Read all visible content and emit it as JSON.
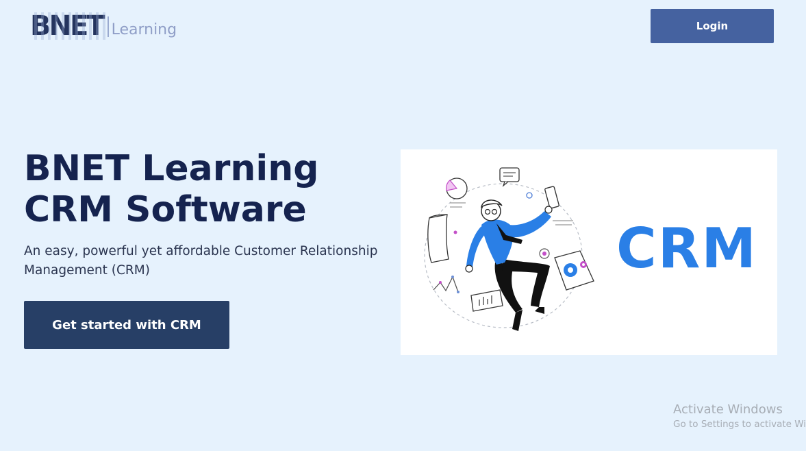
{
  "header": {
    "logo_mark": "BNET",
    "logo_word": "Learning",
    "login_label": "Login"
  },
  "hero": {
    "title": "BNET Learning CRM Software",
    "subtitle": "An easy, powerful yet affordable Customer Relationship Management (CRM)",
    "cta_label": "Get started with CRM",
    "image_text": "CRM"
  },
  "watermark": {
    "line1": "Activate Windows",
    "line2": "Go to Settings to activate Windows."
  },
  "colors": {
    "background": "#e6f2fd",
    "login_button": "#4562a0",
    "cta_button": "#273f66",
    "title": "#15234f",
    "crm_blue": "#2a7fe6"
  },
  "icons": [
    "logo-icon",
    "chat-bubble-icon",
    "pie-chart-icon",
    "smartphone-icon",
    "gear-icon",
    "bar-chart-icon",
    "line-chart-icon",
    "target-icon"
  ]
}
